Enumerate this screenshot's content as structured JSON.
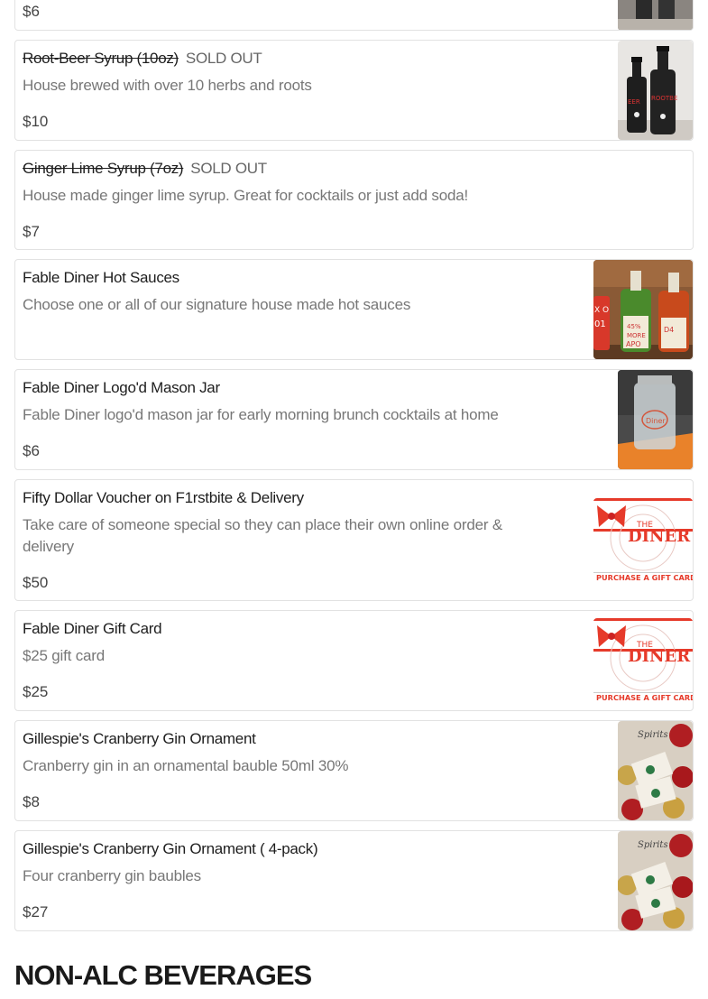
{
  "items": [
    {
      "name": "",
      "desc": "",
      "price": "$6"
    },
    {
      "name": "Root-Beer Syrup (10oz)",
      "sold_out": "SOLD OUT",
      "desc": "House brewed with over 10 herbs and roots",
      "price": "$10"
    },
    {
      "name": "Ginger Lime Syrup (7oz)",
      "sold_out": "SOLD OUT",
      "desc": "House made ginger lime syrup. Great for cocktails or just add soda!",
      "price": "$7"
    },
    {
      "name": "Fable Diner Hot Sauces",
      "desc": "Choose one or all of our signature house made hot sauces",
      "price": ""
    },
    {
      "name": "Fable Diner Logo'd Mason Jar",
      "desc": "Fable Diner logo'd mason jar for early morning brunch cocktails at home",
      "price": "$6"
    },
    {
      "name": "Fifty Dollar Voucher on F1rstbite & Delivery",
      "desc_line1": "Take care of someone special so they can place their own online order &",
      "desc_line2": "delivery",
      "price": "$50"
    },
    {
      "name": "Fable Diner Gift Card",
      "desc": "$25 gift card",
      "price": "$25"
    },
    {
      "name": "Gillespie's Cranberry Gin Ornament",
      "desc": "Cranberry gin in an ornamental bauble 50ml 30%",
      "price": "$8"
    },
    {
      "name": "Gillespie's Cranberry Gin Ornament ( 4-pack)",
      "desc": "Four cranberry gin baubles",
      "price": "$27"
    }
  ],
  "gift_card": {
    "line1": "THE",
    "line2": "DINER",
    "cta": "PURCHASE A GIFT CARD"
  },
  "sections": {
    "next": "NON-ALC BEVERAGES"
  },
  "colors": {
    "accent_red": "#e63a2a",
    "border": "#e2e2e2"
  }
}
